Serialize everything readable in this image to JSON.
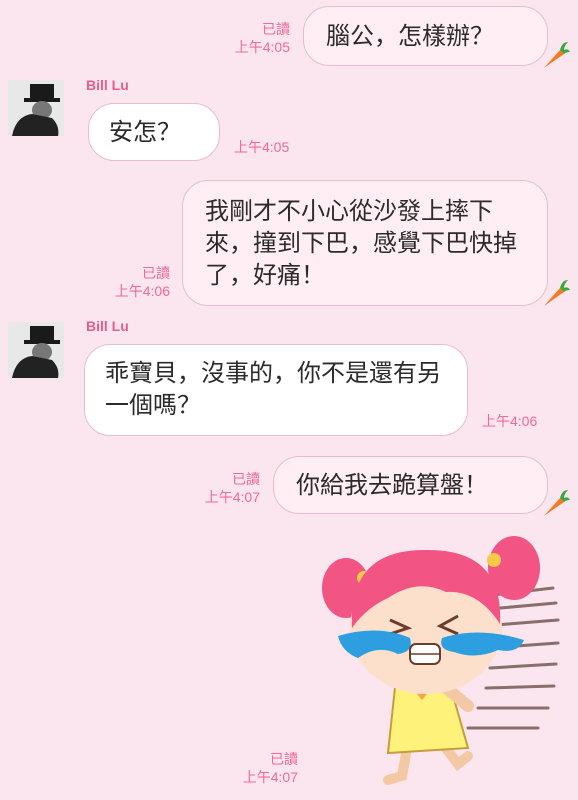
{
  "messages": [
    {
      "side": "right",
      "text": "腦公，怎樣辦？",
      "read": "已讀",
      "time": "上午4:05"
    },
    {
      "side": "left",
      "sender": "Bill Lu",
      "text": "安怎？",
      "time": "上午4:05"
    },
    {
      "side": "right",
      "text": "我剛才不小心從沙發上摔下來，撞到下巴，感覺下巴快掉了，好痛！",
      "read": "已讀",
      "time": "上午4:06"
    },
    {
      "side": "left",
      "sender": "Bill Lu",
      "text": "乖寶貝，沒事的，你不是還有另一個嗎？",
      "time": "上午4:06"
    },
    {
      "side": "right",
      "text": "你給我去跪算盤！",
      "read": "已讀",
      "time": "上午4:07"
    },
    {
      "side": "right",
      "type": "sticker",
      "sticker": "crying-running-girl-sticker",
      "read": "已讀",
      "time": "上午4:07"
    }
  ],
  "colors": {
    "background": "#fbe6ef",
    "timestamp": "#f26a94",
    "sender": "#e65e8b",
    "bubble_border": "#e9bccd"
  },
  "icons": {
    "carrot": "carrot-icon",
    "avatar": "top-hat-avatar"
  }
}
